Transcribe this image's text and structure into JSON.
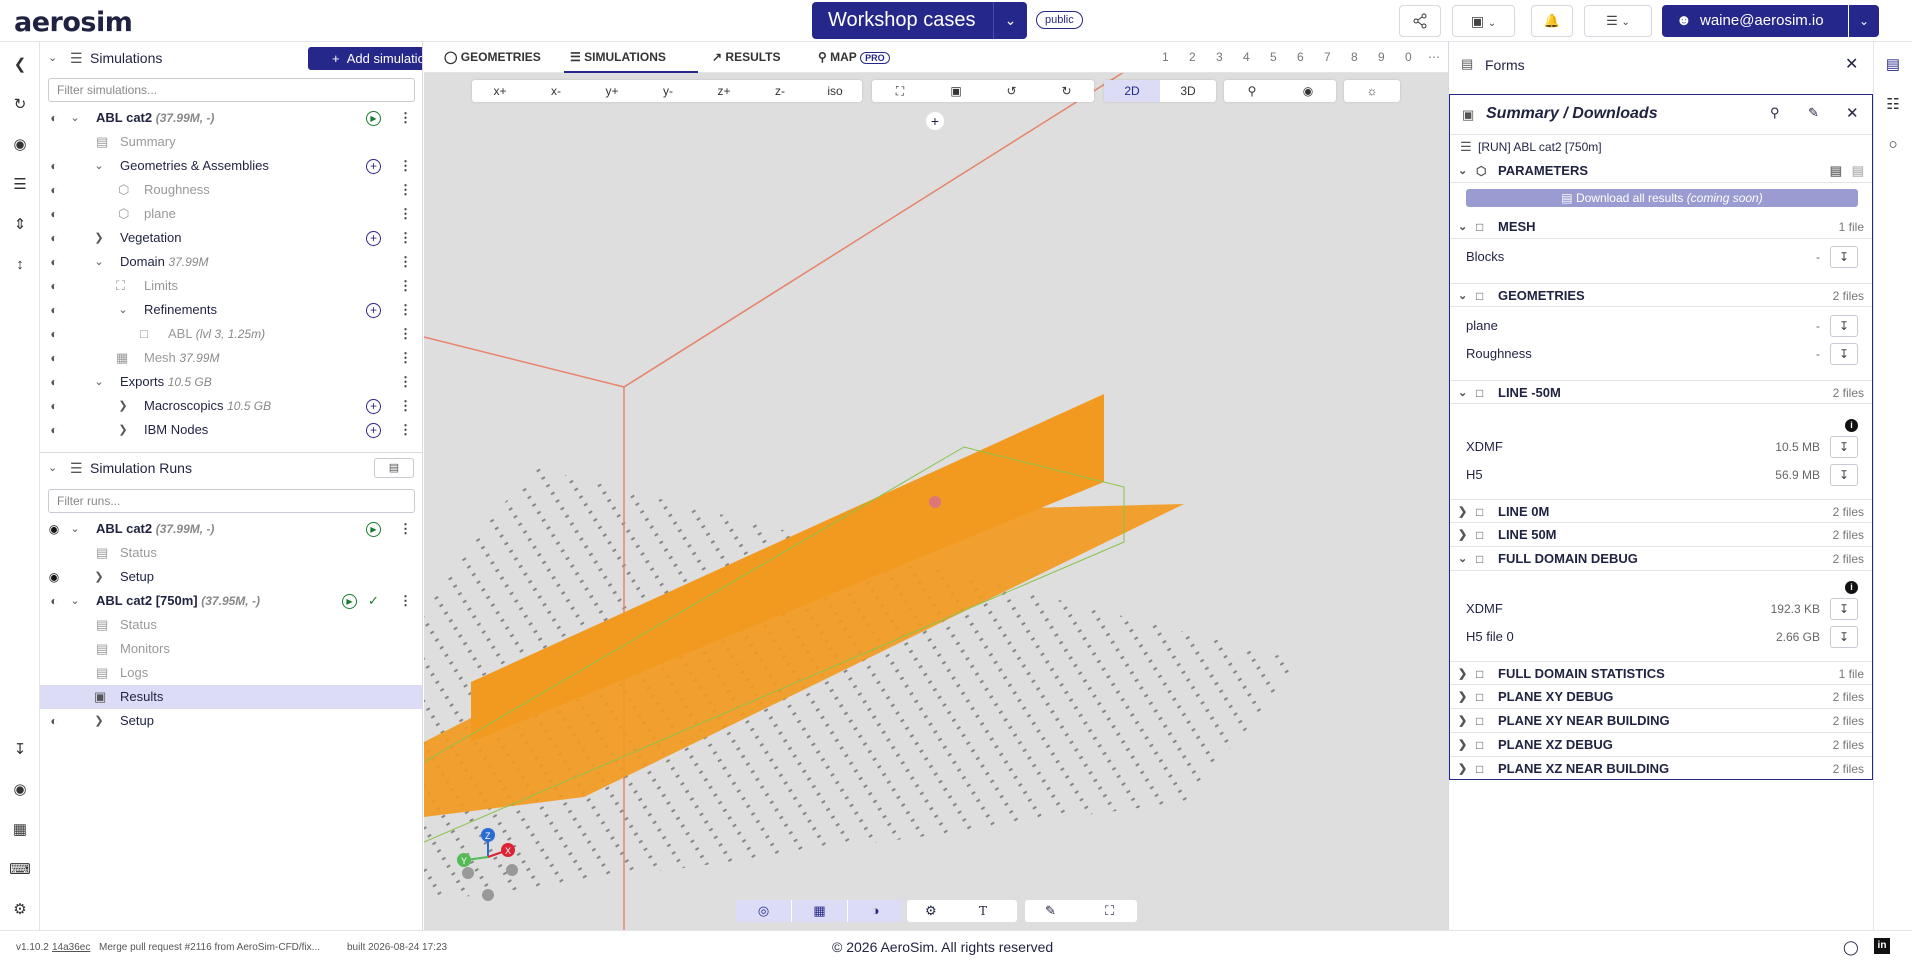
{
  "app": {
    "logo": "aerosim",
    "project": "Workshop cases",
    "visibility": "public",
    "user": "waine@aerosim.io"
  },
  "simulations": {
    "title": "Simulations",
    "add_label": "Add simulation",
    "filter_placeholder": "Filter simulations...",
    "rows": [
      {
        "label": "ABL cat2",
        "sub": "(37.99M, -)"
      },
      {
        "label": "Summary"
      },
      {
        "label": "Geometries & Assemblies"
      },
      {
        "label": "Roughness"
      },
      {
        "label": "plane"
      },
      {
        "label": "Vegetation"
      },
      {
        "label": "Domain",
        "sub": "37.99M"
      },
      {
        "label": "Limits"
      },
      {
        "label": "Refinements"
      },
      {
        "label": "ABL",
        "sub": "(lvl 3, 1.25m)"
      },
      {
        "label": "Mesh",
        "sub": "37.99M"
      },
      {
        "label": "Exports",
        "sub": "10.5 GB"
      },
      {
        "label": "Macroscopics",
        "sub": "10.5 GB"
      },
      {
        "label": "IBM Nodes"
      }
    ]
  },
  "runs": {
    "title": "Simulation Runs",
    "filter_placeholder": "Filter runs...",
    "rows": [
      {
        "label": "ABL cat2",
        "sub": "(37.99M, -)"
      },
      {
        "label": "Status"
      },
      {
        "label": "Setup"
      },
      {
        "label": "ABL cat2 [750m]",
        "sub": "(37.95M, -)"
      },
      {
        "label": "Status"
      },
      {
        "label": "Monitors"
      },
      {
        "label": "Logs"
      },
      {
        "label": "Results"
      },
      {
        "label": "Setup"
      }
    ]
  },
  "viewport": {
    "tabs": [
      "GEOMETRIES",
      "SIMULATIONS",
      "RESULTS",
      "MAP"
    ],
    "map_badge": "PRO",
    "layer_numbers": [
      "1",
      "2",
      "3",
      "4",
      "5",
      "6",
      "7",
      "8",
      "9",
      "0"
    ],
    "more": "⋯",
    "view_buttons": [
      "x+",
      "x-",
      "y+",
      "y-",
      "z+",
      "z-",
      "iso"
    ],
    "mode_buttons": [
      "2D",
      "3D"
    ],
    "add": "+",
    "axes": {
      "x": "X",
      "y": "Y",
      "z": "Z"
    },
    "bottom_tool_t": "T"
  },
  "forms": {
    "title": "Forms",
    "panel_title": "Summary / Downloads",
    "run_label": "[RUN] ABL cat2 [750m]",
    "parameters": "PARAMETERS",
    "download_all": "Download all results",
    "coming_soon": "(coming soon)",
    "groups": [
      {
        "name": "MESH",
        "count": "1 file",
        "open": true,
        "files": [
          {
            "name": "Blocks",
            "size": "-"
          }
        ]
      },
      {
        "name": "GEOMETRIES",
        "count": "2 files",
        "open": true,
        "files": [
          {
            "name": "plane",
            "size": "-"
          },
          {
            "name": "Roughness",
            "size": "-"
          }
        ]
      },
      {
        "name": "LINE -50M",
        "count": "2 files",
        "open": true,
        "files": [
          {
            "name": "XDMF",
            "size": "10.5 MB"
          },
          {
            "name": "H5",
            "size": "56.9 MB"
          }
        ]
      },
      {
        "name": "LINE 0M",
        "count": "2 files",
        "open": false
      },
      {
        "name": "LINE 50M",
        "count": "2 files",
        "open": false
      },
      {
        "name": "FULL DOMAIN DEBUG",
        "count": "2 files",
        "open": true,
        "files": [
          {
            "name": "XDMF",
            "size": "192.3 KB"
          },
          {
            "name": "H5 file 0",
            "size": "2.66 GB"
          }
        ]
      },
      {
        "name": "FULL DOMAIN STATISTICS",
        "count": "1 file",
        "open": false
      },
      {
        "name": "PLANE XY DEBUG",
        "count": "2 files",
        "open": false
      },
      {
        "name": "PLANE XY NEAR BUILDING",
        "count": "2 files",
        "open": false
      },
      {
        "name": "PLANE XZ DEBUG",
        "count": "2 files",
        "open": false
      },
      {
        "name": "PLANE XZ NEAR BUILDING",
        "count": "2 files",
        "open": false
      }
    ]
  },
  "status": {
    "version": "v1.10.2",
    "commit": "14a36ec",
    "message": "Merge pull request #2116 from AeroSim-CFD/fix...",
    "built": "built 2026-08-24 17:23",
    "copyright": "© 2026 AeroSim. All rights reserved"
  },
  "colors": {
    "brand": "#25278a",
    "model": "#f29a1f",
    "domain_line": "#e8836a",
    "selected_row": "#dcdcf6"
  }
}
